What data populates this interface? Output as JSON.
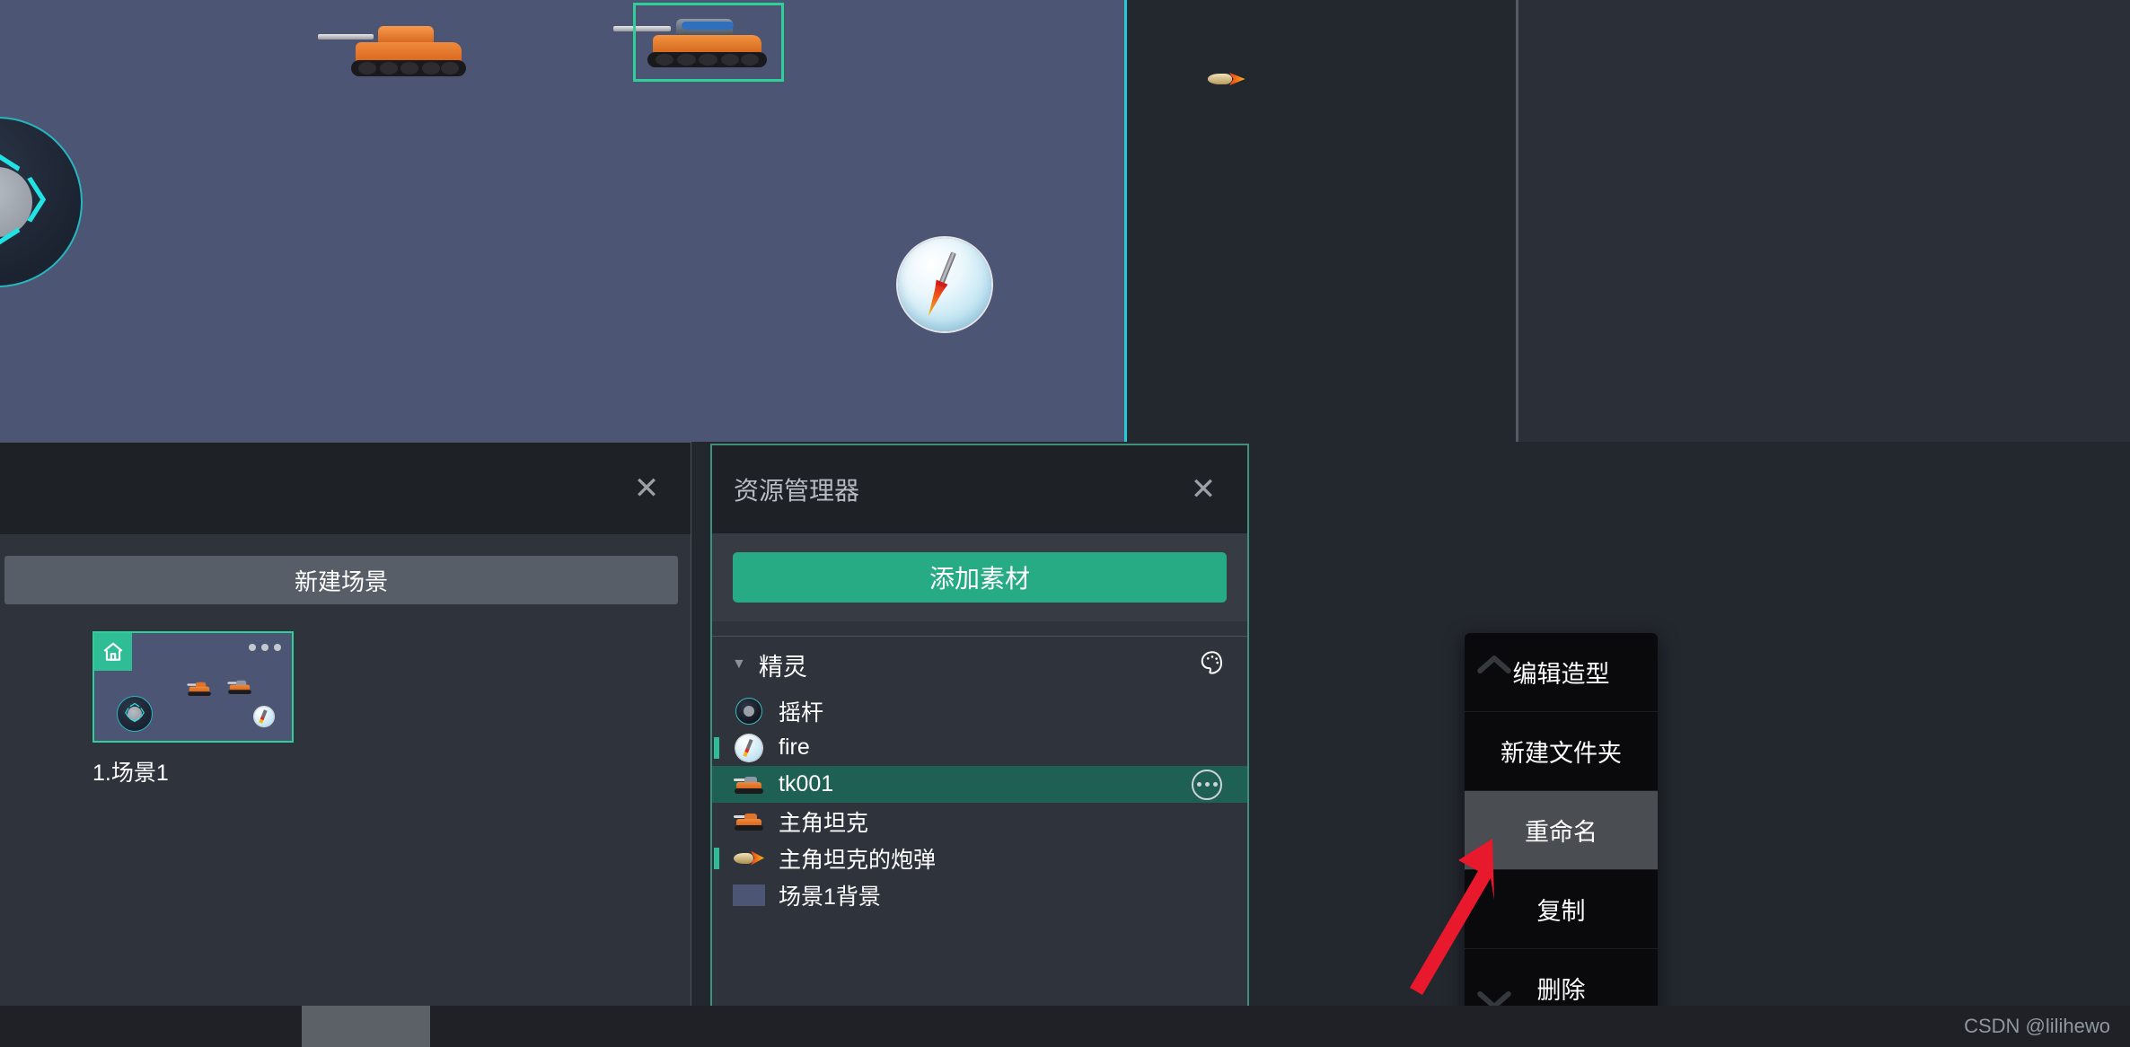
{
  "app": {
    "canvas": {
      "sprites": [
        {
          "name": "主角坦克",
          "type": "tank-orange"
        },
        {
          "name": "tk001",
          "type": "tank-blue",
          "selected": true
        },
        {
          "name": "摇杆",
          "type": "joystick"
        },
        {
          "name": "fire",
          "type": "fire-button"
        },
        {
          "name": "主角坦克的炮弹",
          "type": "bullet"
        }
      ]
    }
  },
  "scene_panel": {
    "close_label": "✕",
    "new_scene_label": "新建场景",
    "scenes": [
      {
        "label": "1.场景1",
        "is_home": true,
        "more_icon": "more-dots-icon"
      }
    ]
  },
  "resource_panel": {
    "title": "资源管理器",
    "close_label": "✕",
    "add_button_label": "添加素材",
    "section": {
      "caret": "▼",
      "title": "精灵",
      "palette_icon": "palette-icon"
    },
    "items": [
      {
        "label": "摇杆",
        "icon": "joystick-icon",
        "marked": false,
        "selected": false
      },
      {
        "label": "fire",
        "icon": "fire-icon",
        "marked": true,
        "selected": false
      },
      {
        "label": "tk001",
        "icon": "tank-icon",
        "marked": false,
        "selected": true,
        "more_icon": "more-dots-icon"
      },
      {
        "label": "主角坦克",
        "icon": "tank-icon",
        "marked": false,
        "selected": false
      },
      {
        "label": "主角坦克的炮弹",
        "icon": "shell-icon",
        "marked": true,
        "selected": false
      },
      {
        "label": "场景1背景",
        "icon": "background-icon",
        "marked": false,
        "selected": false
      }
    ]
  },
  "context_menu": {
    "scroll_up_icon": "chevron-up-icon",
    "scroll_down_icon": "chevron-down-icon",
    "items": [
      {
        "label": "编辑造型",
        "highlighted": false
      },
      {
        "label": "新建文件夹",
        "highlighted": false
      },
      {
        "label": "重命名",
        "highlighted": true
      },
      {
        "label": "复制",
        "highlighted": false
      },
      {
        "label": "删除",
        "highlighted": false
      }
    ]
  },
  "annotation": {
    "arrow": "red-arrow-pointing-to-more-button"
  },
  "footer": {
    "watermark": "CSDN @lilihewo"
  },
  "colors": {
    "accent_green": "#27ab85",
    "selected_row": "#1f6054",
    "panel_bg": "#2f343c",
    "header_bg": "#1e2126",
    "stage_bg": "#4d5574",
    "cyan_border": "#22c9d6",
    "menu_bg": "#0a0a0c",
    "menu_highlight": "#4a4d52",
    "arrow_red": "#e8192c"
  }
}
